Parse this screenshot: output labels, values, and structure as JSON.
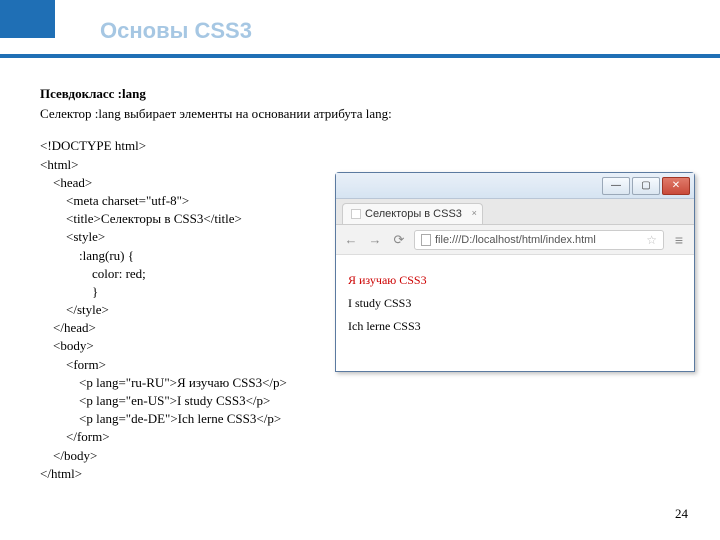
{
  "header": {
    "title": "Основы CSS3"
  },
  "section": {
    "subtitle": "Псевдокласс :lang",
    "description": "Селектор :lang выбирает элементы на основании атрибута lang:"
  },
  "code": {
    "l1": "<!DOCTYPE html>",
    "l2": "<html>",
    "l3": "    <head>",
    "l4": "        <meta charset=\"utf-8\">",
    "l5": "        <title>Селекторы в CSS3</title>",
    "l6": "        <style>",
    "l7": "            :lang(ru) {",
    "l8": "                color: red;",
    "l9": "                }",
    "l10": "        </style>",
    "l11": "    </head>",
    "l12": "    <body>",
    "l13": "        <form>",
    "l14": "            <p lang=\"ru-RU\">Я изучаю CSS3</p>",
    "l15": "            <p lang=\"en-US\">I study CSS3</p>",
    "l16": "            <p lang=\"de-DE\">Ich lerne CSS3</p>",
    "l17": "        </form>",
    "l18": "    </body>",
    "l19": "</html>"
  },
  "browser": {
    "tab_title": "Селекторы в CSS3",
    "url": "file:///D:/localhost/html/index.html",
    "win": {
      "min": "—",
      "max": "▢",
      "close": "✕"
    },
    "nav": {
      "back": "←",
      "fwd": "→",
      "reload": "⟳",
      "menu": "≡",
      "star": "☆",
      "tab_x": "×"
    },
    "page": {
      "p1": "Я изучаю CSS3",
      "p2": "I study CSS3",
      "p3": "Ich lerne CSS3"
    }
  },
  "page_number": "24"
}
